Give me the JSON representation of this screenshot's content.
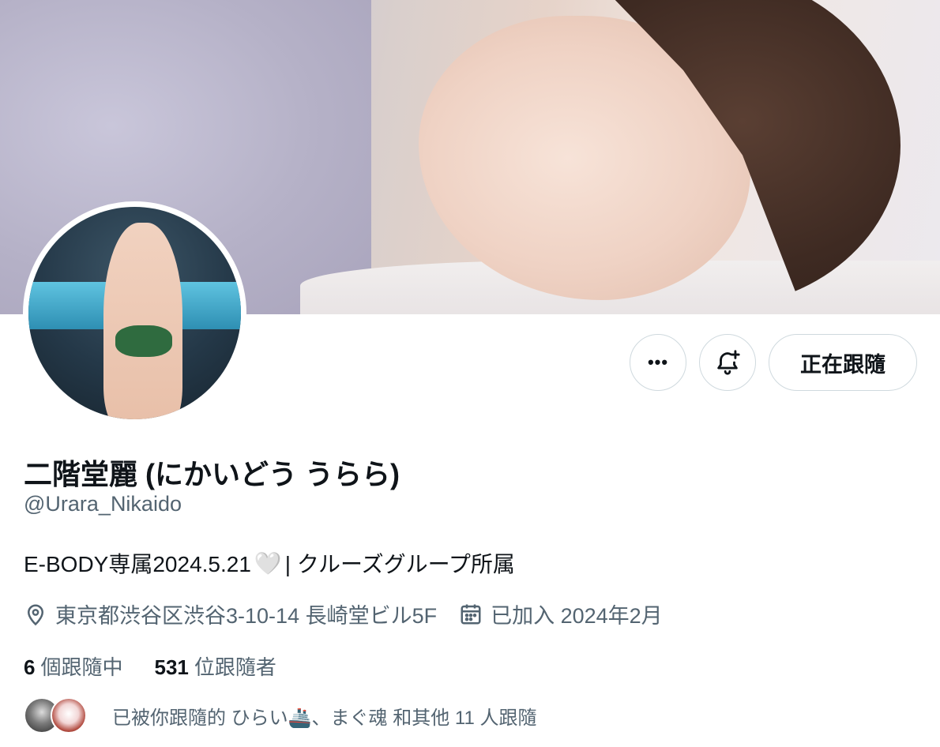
{
  "profile": {
    "display_name": "二階堂麗 (にかいどう うらら)",
    "handle": "@Urara_Nikaido",
    "bio_part1": "E-BODY専属2024.5.21",
    "bio_heart": "🤍",
    "bio_part2": " | クルーズグループ所属",
    "location": "東京都渋谷区渋谷3-10-14 長崎堂ビル5F",
    "joined": "已加入 2024年2月",
    "following_count": "6",
    "following_label": "個跟隨中",
    "followers_count": "531",
    "followers_label": "位跟隨者",
    "followed_by_text": "已被你跟隨的 ひらい🚢、まぐ魂 和其他 11 人跟隨"
  },
  "actions": {
    "more_label": "•••",
    "follow_label": "正在跟隨"
  },
  "icons": {
    "more": "more-horizontal-icon",
    "notify": "bell-plus-icon",
    "location": "location-pin-icon",
    "joined": "calendar-icon"
  },
  "colors": {
    "text_primary": "#0f1419",
    "text_secondary": "#536471",
    "border": "#cfd9de"
  }
}
